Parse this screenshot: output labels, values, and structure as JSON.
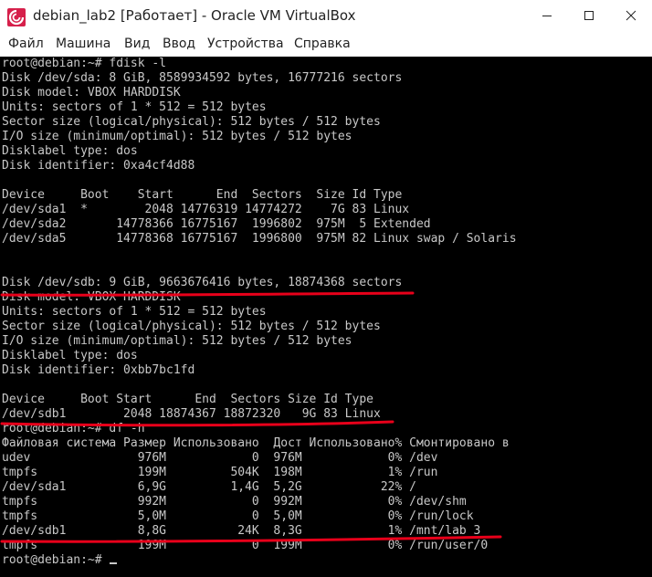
{
  "window": {
    "title": "debian_lab2 [Работает] - Oracle VM VirtualBox",
    "colors": {
      "icon": "#d6204b",
      "terminal_bg": "#000000",
      "terminal_text": "#c8c8c8",
      "annotation": "#e8001a"
    }
  },
  "menu": {
    "items": [
      {
        "label": "Файл"
      },
      {
        "label": "Машина"
      },
      {
        "label": "Вид"
      },
      {
        "label": "Ввод"
      },
      {
        "label": "Устройства"
      },
      {
        "label": "Справка"
      }
    ]
  },
  "terminal": {
    "lines": [
      "root@debian:~# fdisk -l",
      "Disk /dev/sda: 8 GiB, 8589934592 bytes, 16777216 sectors",
      "Disk model: VBOX HARDDISK",
      "Units: sectors of 1 * 512 = 512 bytes",
      "Sector size (logical/physical): 512 bytes / 512 bytes",
      "I/O size (minimum/optimal): 512 bytes / 512 bytes",
      "Disklabel type: dos",
      "Disk identifier: 0xa4cf4d88",
      "",
      "Device     Boot    Start      End  Sectors  Size Id Type",
      "/dev/sda1  *        2048 14776319 14774272    7G 83 Linux",
      "/dev/sda2       14778366 16775167  1996802  975M  5 Extended",
      "/dev/sda5       14778368 16775167  1996800  975M 82 Linux swap / Solaris",
      "",
      "",
      "Disk /dev/sdb: 9 GiB, 9663676416 bytes, 18874368 sectors",
      "Disk model: VBOX HARDDISK",
      "Units: sectors of 1 * 512 = 512 bytes",
      "Sector size (logical/physical): 512 bytes / 512 bytes",
      "I/O size (minimum/optimal): 512 bytes / 512 bytes",
      "Disklabel type: dos",
      "Disk identifier: 0xbb7bc1fd",
      "",
      "Device     Boot Start      End  Sectors Size Id Type",
      "/dev/sdb1        2048 18874367 18872320   9G 83 Linux",
      "root@debian:~# df -h",
      "Файловая система Размер Использовано  Дост Использовано% Смонтировано в",
      "udev               976M            0  976M            0% /dev",
      "tmpfs              199M         504K  198M            1% /run",
      "/dev/sda1          6,9G         1,4G  5,2G           22% /",
      "tmpfs              992M            0  992M            0% /dev/shm",
      "tmpfs              5,0M            0  5,0M            0% /run/lock",
      "/dev/sdb1          8,8G          24K  8,3G            1% /mnt/lab_3",
      "tmpfs              199M            0  199M            0% /run/user/0",
      "root@debian:~# "
    ]
  }
}
